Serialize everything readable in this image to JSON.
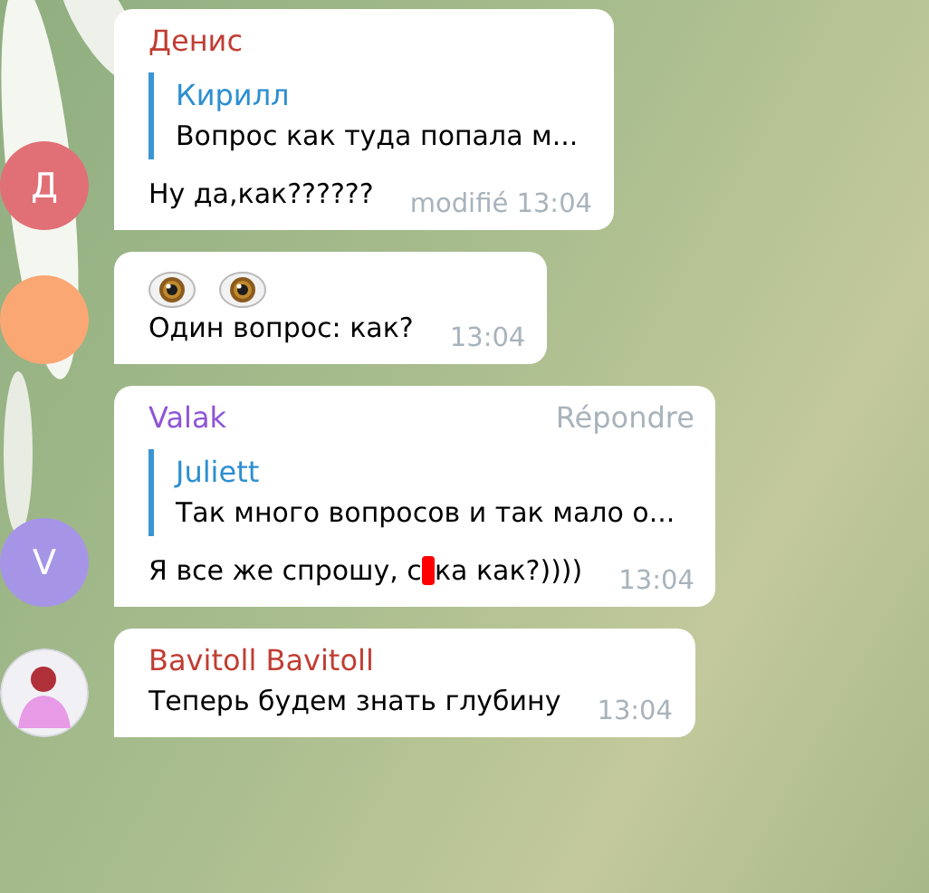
{
  "messages": [
    {
      "avatar": {
        "kind": "letter",
        "letter": "Д",
        "color": "#e17076"
      },
      "sender": {
        "name": "Денис",
        "color": "#c03d33"
      },
      "reply": {
        "author": "Кирилл",
        "text": "Вопрос как туда попала м..."
      },
      "lines": [
        {
          "kind": "text",
          "text": "Ну да,как??????"
        }
      ],
      "edited": "modifié",
      "time": "13:04"
    },
    {
      "avatar": {
        "kind": "blank",
        "color": "#faa774"
      },
      "lines": [
        {
          "kind": "stickers",
          "items": [
            {
              "kind": "eye"
            },
            {
              "kind": "eye"
            }
          ]
        },
        {
          "kind": "text",
          "text": "Один вопрос: как?"
        }
      ],
      "time": "13:04"
    },
    {
      "avatar": {
        "kind": "letter",
        "letter": "V",
        "color": "#a695e7"
      },
      "sender": {
        "name": "Valak",
        "color": "#8e55d7"
      },
      "action": "Répondre",
      "reply": {
        "author": "Juliett",
        "text": "Так много вопросов и так мало о..."
      },
      "lines": [
        {
          "kind": "censored",
          "parts": [
            "Я все же спрошу, с",
            "ка как?))))"
          ]
        }
      ],
      "time": "13:04"
    },
    {
      "avatar": {
        "kind": "photo"
      },
      "sender": {
        "name": "Bavitoll Bavitoll",
        "color": "#c03d33"
      },
      "lines": [
        {
          "kind": "text",
          "text": "Теперь будем знать глубину"
        }
      ],
      "time": "13:04"
    }
  ]
}
